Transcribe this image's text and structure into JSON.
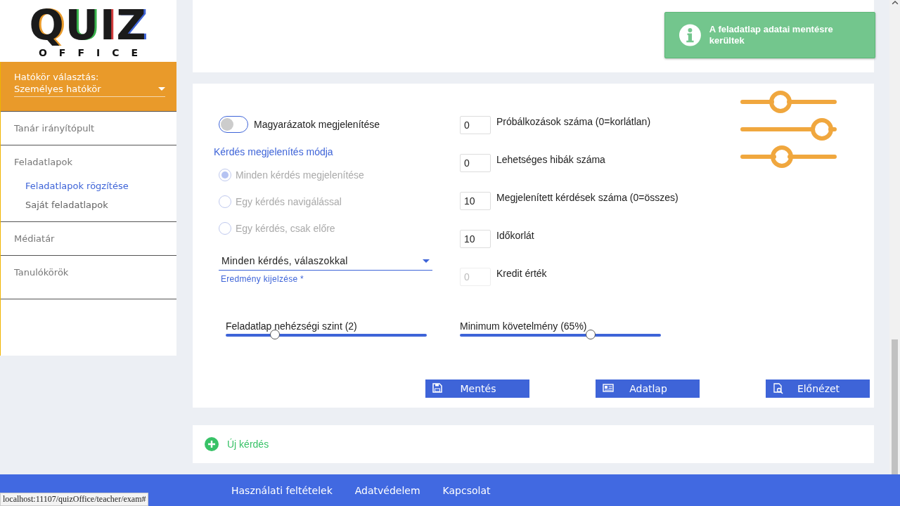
{
  "logo": {
    "title": "QUIZ",
    "subtitle": "OFFICE"
  },
  "scope": {
    "label": "Hatókör választás:",
    "value": "Személyes hatókör"
  },
  "sidebar": {
    "items": [
      {
        "label": "Tanár irányítópult",
        "selected": false
      },
      {
        "label": "Feladatlapok",
        "selected": false,
        "children": [
          {
            "label": "Feladatlapok rögzítése",
            "selected": true
          },
          {
            "label": "Saját feladatlapok",
            "selected": false
          }
        ]
      },
      {
        "label": "Médiatár",
        "selected": false
      },
      {
        "label": "Tanulókörök",
        "selected": false
      }
    ]
  },
  "toast": {
    "message": "A feladatlap adatai mentésre kerültek"
  },
  "settings": {
    "explanations": {
      "label": "Magyarázatok megjelenítése",
      "on": false
    },
    "display_mode": {
      "title": "Kérdés megjelenítés módja",
      "options": [
        {
          "label": "Minden kérdés megjelenítése",
          "selected": true,
          "disabled": true
        },
        {
          "label": "Egy kérdés navigálással",
          "selected": false,
          "disabled": true
        },
        {
          "label": "Egy kérdés, csak előre",
          "selected": false,
          "disabled": true
        }
      ]
    },
    "result_display": {
      "value": "Minden kérdés, válaszokkal",
      "label": "Eredmény kijelzése *"
    },
    "number_fields": [
      {
        "value": "0",
        "label": "Próbálkozások száma (0=korlátlan)",
        "disabled": false
      },
      {
        "value": "0",
        "label": "Lehetséges hibák száma",
        "disabled": false
      },
      {
        "value": "10",
        "label": "Megjelenített kérdések száma (0=összes)",
        "disabled": false
      },
      {
        "value": "10",
        "label": "Időkorlát",
        "disabled": false
      },
      {
        "value": "0",
        "label": "Kredit érték",
        "disabled": true
      }
    ],
    "sliders": [
      {
        "label": "Feladatlap nehézségi szint (2)",
        "level": 0.245
      },
      {
        "label": "Minimum követelmény (65%)",
        "level": 0.65
      }
    ],
    "buttons": [
      {
        "label": "Mentés",
        "kind": "save"
      },
      {
        "label": "Adatlap",
        "kind": "card"
      },
      {
        "label": "Előnézet",
        "kind": "preview"
      }
    ]
  },
  "new_question": {
    "label": "Új kérdés"
  },
  "footer": {
    "links": [
      "Használati feltételek",
      "Adatvédelem",
      "Kapcsolat"
    ]
  },
  "status_url": "localhost:11107/quizOffice/teacher/exam#"
}
